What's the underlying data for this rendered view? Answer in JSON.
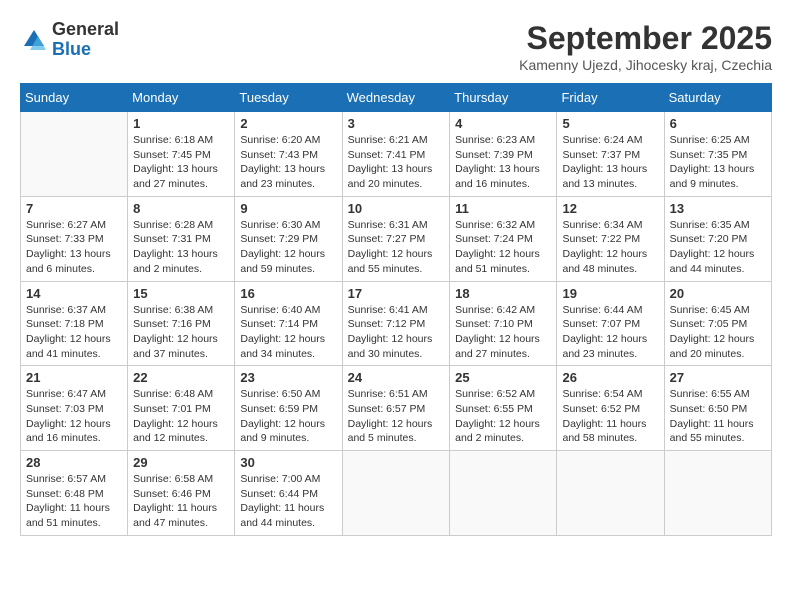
{
  "header": {
    "logo_general": "General",
    "logo_blue": "Blue",
    "month_title": "September 2025",
    "location": "Kamenny Ujezd, Jihocesky kraj, Czechia"
  },
  "days_of_week": [
    "Sunday",
    "Monday",
    "Tuesday",
    "Wednesday",
    "Thursday",
    "Friday",
    "Saturday"
  ],
  "weeks": [
    [
      {
        "day": "",
        "info": ""
      },
      {
        "day": "1",
        "info": "Sunrise: 6:18 AM\nSunset: 7:45 PM\nDaylight: 13 hours\nand 27 minutes."
      },
      {
        "day": "2",
        "info": "Sunrise: 6:20 AM\nSunset: 7:43 PM\nDaylight: 13 hours\nand 23 minutes."
      },
      {
        "day": "3",
        "info": "Sunrise: 6:21 AM\nSunset: 7:41 PM\nDaylight: 13 hours\nand 20 minutes."
      },
      {
        "day": "4",
        "info": "Sunrise: 6:23 AM\nSunset: 7:39 PM\nDaylight: 13 hours\nand 16 minutes."
      },
      {
        "day": "5",
        "info": "Sunrise: 6:24 AM\nSunset: 7:37 PM\nDaylight: 13 hours\nand 13 minutes."
      },
      {
        "day": "6",
        "info": "Sunrise: 6:25 AM\nSunset: 7:35 PM\nDaylight: 13 hours\nand 9 minutes."
      }
    ],
    [
      {
        "day": "7",
        "info": "Sunrise: 6:27 AM\nSunset: 7:33 PM\nDaylight: 13 hours\nand 6 minutes."
      },
      {
        "day": "8",
        "info": "Sunrise: 6:28 AM\nSunset: 7:31 PM\nDaylight: 13 hours\nand 2 minutes."
      },
      {
        "day": "9",
        "info": "Sunrise: 6:30 AM\nSunset: 7:29 PM\nDaylight: 12 hours\nand 59 minutes."
      },
      {
        "day": "10",
        "info": "Sunrise: 6:31 AM\nSunset: 7:27 PM\nDaylight: 12 hours\nand 55 minutes."
      },
      {
        "day": "11",
        "info": "Sunrise: 6:32 AM\nSunset: 7:24 PM\nDaylight: 12 hours\nand 51 minutes."
      },
      {
        "day": "12",
        "info": "Sunrise: 6:34 AM\nSunset: 7:22 PM\nDaylight: 12 hours\nand 48 minutes."
      },
      {
        "day": "13",
        "info": "Sunrise: 6:35 AM\nSunset: 7:20 PM\nDaylight: 12 hours\nand 44 minutes."
      }
    ],
    [
      {
        "day": "14",
        "info": "Sunrise: 6:37 AM\nSunset: 7:18 PM\nDaylight: 12 hours\nand 41 minutes."
      },
      {
        "day": "15",
        "info": "Sunrise: 6:38 AM\nSunset: 7:16 PM\nDaylight: 12 hours\nand 37 minutes."
      },
      {
        "day": "16",
        "info": "Sunrise: 6:40 AM\nSunset: 7:14 PM\nDaylight: 12 hours\nand 34 minutes."
      },
      {
        "day": "17",
        "info": "Sunrise: 6:41 AM\nSunset: 7:12 PM\nDaylight: 12 hours\nand 30 minutes."
      },
      {
        "day": "18",
        "info": "Sunrise: 6:42 AM\nSunset: 7:10 PM\nDaylight: 12 hours\nand 27 minutes."
      },
      {
        "day": "19",
        "info": "Sunrise: 6:44 AM\nSunset: 7:07 PM\nDaylight: 12 hours\nand 23 minutes."
      },
      {
        "day": "20",
        "info": "Sunrise: 6:45 AM\nSunset: 7:05 PM\nDaylight: 12 hours\nand 20 minutes."
      }
    ],
    [
      {
        "day": "21",
        "info": "Sunrise: 6:47 AM\nSunset: 7:03 PM\nDaylight: 12 hours\nand 16 minutes."
      },
      {
        "day": "22",
        "info": "Sunrise: 6:48 AM\nSunset: 7:01 PM\nDaylight: 12 hours\nand 12 minutes."
      },
      {
        "day": "23",
        "info": "Sunrise: 6:50 AM\nSunset: 6:59 PM\nDaylight: 12 hours\nand 9 minutes."
      },
      {
        "day": "24",
        "info": "Sunrise: 6:51 AM\nSunset: 6:57 PM\nDaylight: 12 hours\nand 5 minutes."
      },
      {
        "day": "25",
        "info": "Sunrise: 6:52 AM\nSunset: 6:55 PM\nDaylight: 12 hours\nand 2 minutes."
      },
      {
        "day": "26",
        "info": "Sunrise: 6:54 AM\nSunset: 6:52 PM\nDaylight: 11 hours\nand 58 minutes."
      },
      {
        "day": "27",
        "info": "Sunrise: 6:55 AM\nSunset: 6:50 PM\nDaylight: 11 hours\nand 55 minutes."
      }
    ],
    [
      {
        "day": "28",
        "info": "Sunrise: 6:57 AM\nSunset: 6:48 PM\nDaylight: 11 hours\nand 51 minutes."
      },
      {
        "day": "29",
        "info": "Sunrise: 6:58 AM\nSunset: 6:46 PM\nDaylight: 11 hours\nand 47 minutes."
      },
      {
        "day": "30",
        "info": "Sunrise: 7:00 AM\nSunset: 6:44 PM\nDaylight: 11 hours\nand 44 minutes."
      },
      {
        "day": "",
        "info": ""
      },
      {
        "day": "",
        "info": ""
      },
      {
        "day": "",
        "info": ""
      },
      {
        "day": "",
        "info": ""
      }
    ]
  ]
}
